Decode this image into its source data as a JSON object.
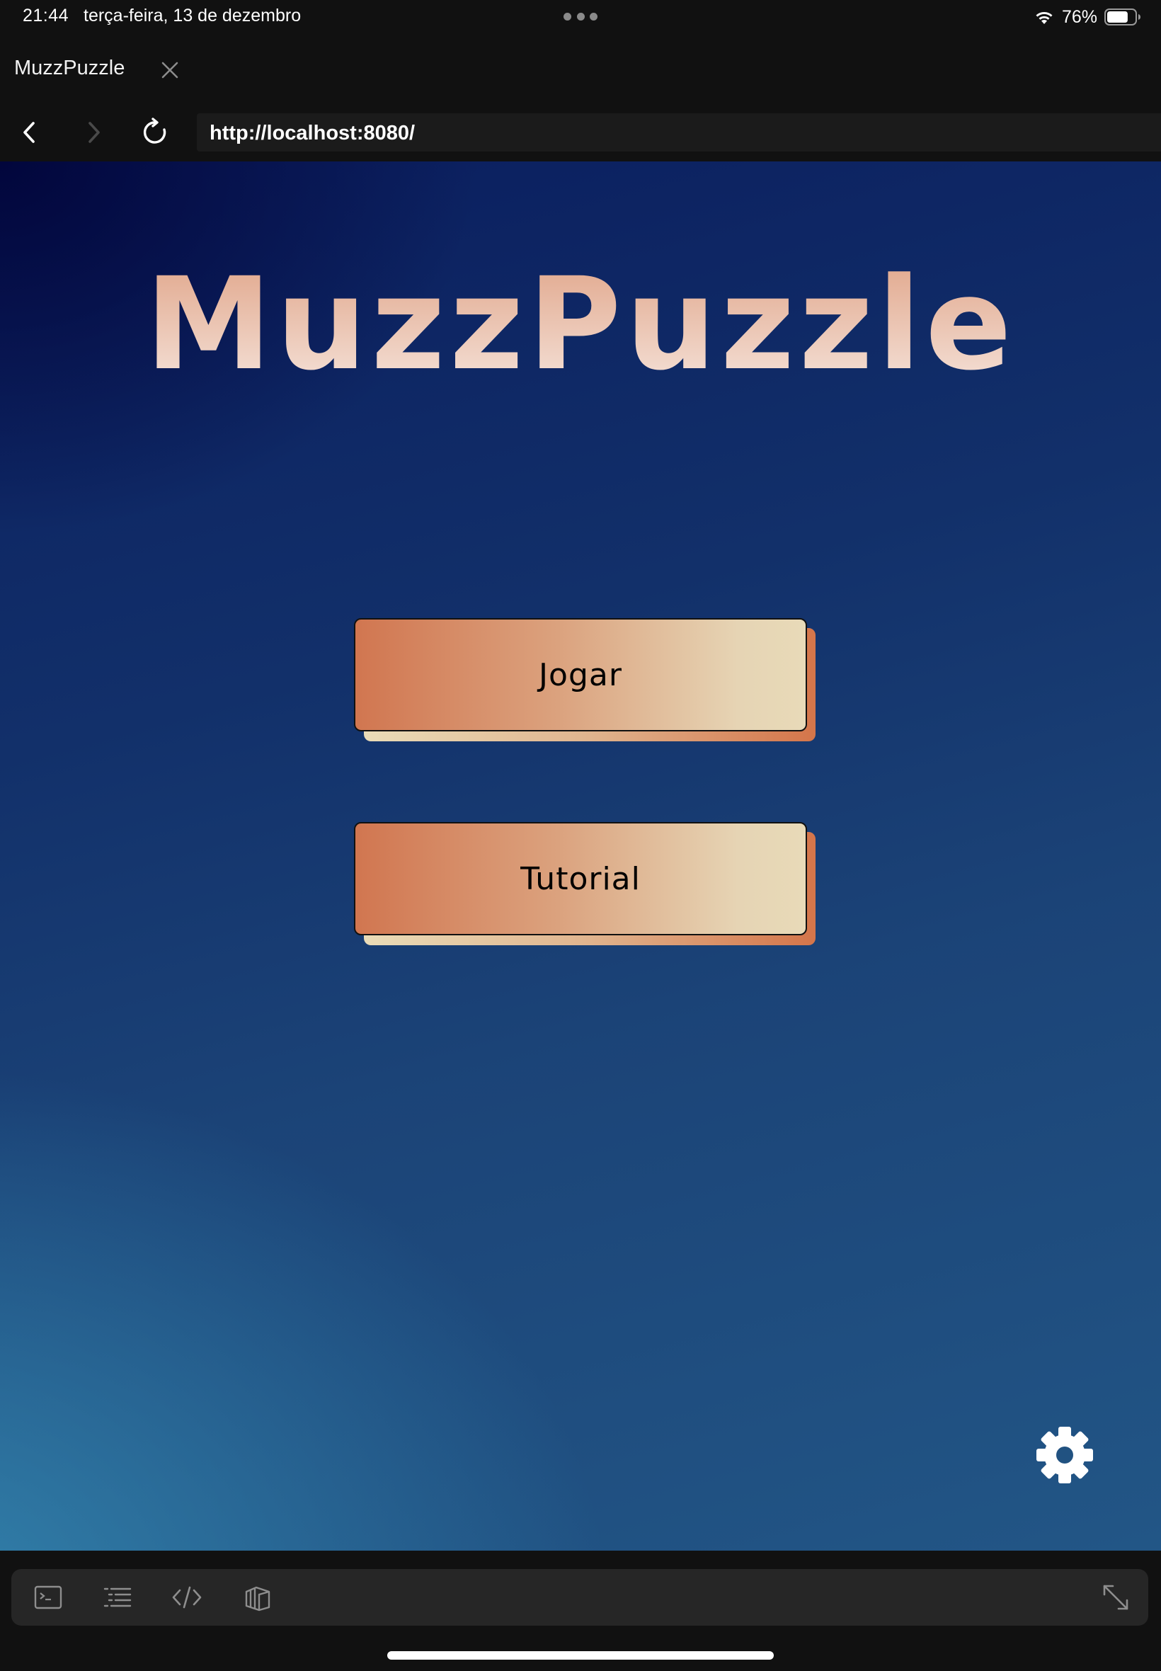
{
  "status_bar": {
    "time": "21:44",
    "date": "terça-feira, 13 de dezembro",
    "battery_percent": "76%",
    "battery_level": 0.76,
    "icons": [
      "wifi-icon",
      "battery-icon"
    ]
  },
  "browser": {
    "tab_title": "MuzzPuzzle",
    "url": "http://localhost:8080/",
    "icons": [
      "close-icon",
      "back-icon",
      "forward-icon",
      "reload-icon"
    ]
  },
  "page": {
    "title": "MuzzPuzzle",
    "buttons": {
      "play": "Jogar",
      "tutorial": "Tutorial"
    },
    "settings_icon": "gear-icon"
  },
  "dev_toolbar": {
    "icons": [
      "console-icon",
      "list-icon",
      "code-icon",
      "layers-icon",
      "expand-icon"
    ]
  },
  "colors": {
    "background_top": "#0a1d5e",
    "background_bottom": "#225686",
    "button_orange": "#d17650",
    "button_cream": "#e8dab8",
    "title_top": "#e0a488",
    "title_bottom": "#f6e6de"
  }
}
